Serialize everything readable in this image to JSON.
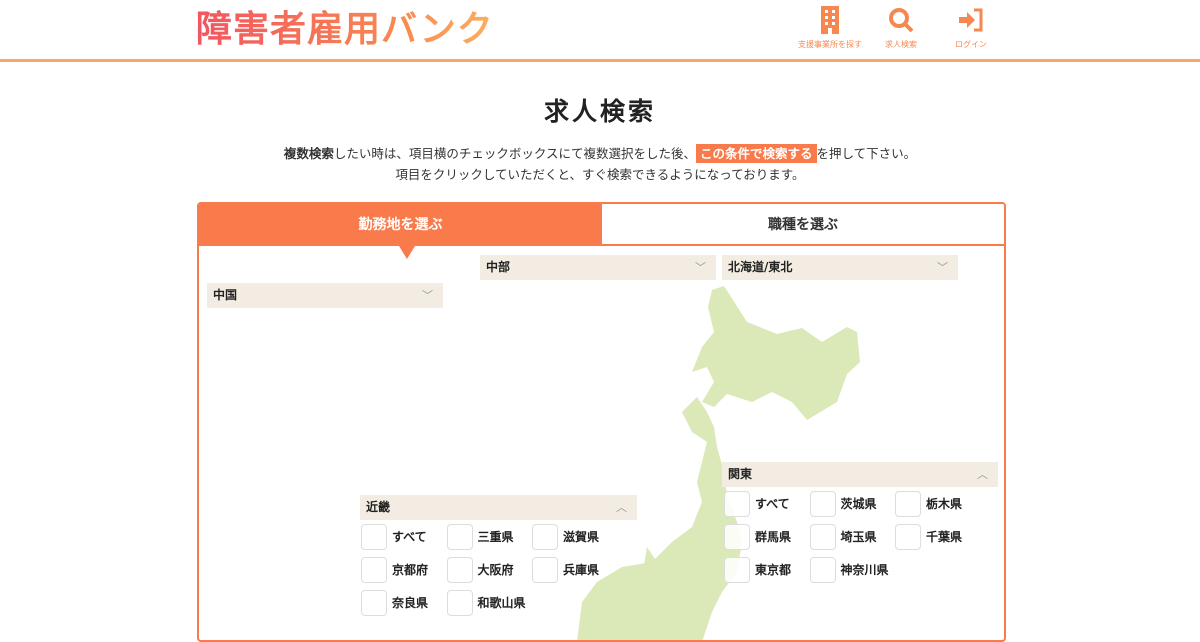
{
  "header": {
    "logo": "障害者雇用バンク",
    "nav": [
      {
        "label": "支援事業所を探す",
        "icon": "building-icon"
      },
      {
        "label": "求人検索",
        "icon": "search-icon"
      },
      {
        "label": "ログイン",
        "icon": "login-icon"
      }
    ]
  },
  "page": {
    "title": "求人検索",
    "desc1_a": "複数検索",
    "desc1_b": "したい時は、項目横のチェックボックスにて複数選択をした後、",
    "desc1_hl": "この条件で検索する",
    "desc1_c": "を押して下さい。",
    "desc2": "項目をクリックしていただくと、すぐ検索できるようになっております。"
  },
  "tabs": [
    {
      "label": "勤務地を選ぶ",
      "active": true
    },
    {
      "label": "職種を選ぶ",
      "active": false
    }
  ],
  "regions": {
    "chubu": "中部",
    "tohoku": "北海道/東北",
    "chugoku": "中国",
    "kanto": {
      "label": "関東",
      "items": [
        "すべて",
        "茨城県",
        "栃木県",
        "群馬県",
        "埼玉県",
        "千葉県",
        "東京都",
        "神奈川県"
      ]
    },
    "kinki": {
      "label": "近畿",
      "items": [
        "すべて",
        "三重県",
        "滋賀県",
        "京都府",
        "大阪府",
        "兵庫県",
        "奈良県",
        "和歌山県"
      ]
    }
  },
  "colors": {
    "accent": "#f97a4a",
    "dropdown_bg": "#f3ece2",
    "map": "#dbe8b8"
  }
}
